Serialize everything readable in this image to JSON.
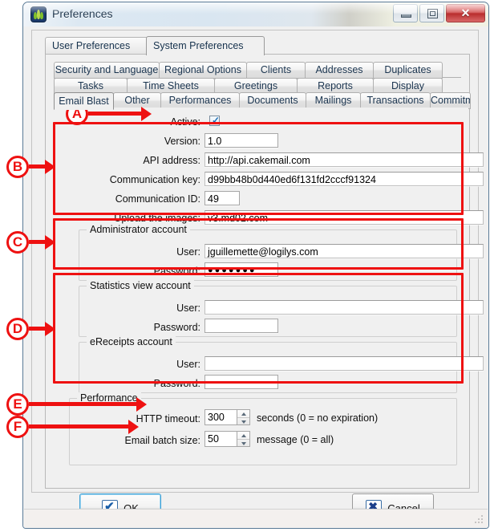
{
  "window": {
    "title": "Preferences",
    "app_icon": "logilys-app-icon",
    "controls": {
      "minimize": "minimize-icon",
      "restore": "restore-icon",
      "close": "✕"
    }
  },
  "tabs_level1": [
    {
      "label": "User Preferences",
      "active": false
    },
    {
      "label": "System Preferences",
      "active": true
    }
  ],
  "tabs_level2_row1": [
    {
      "label": "Security and Language",
      "active": false
    },
    {
      "label": "Regional Options",
      "active": false
    },
    {
      "label": "Clients",
      "active": false
    },
    {
      "label": "Addresses",
      "active": false
    },
    {
      "label": "Duplicates",
      "active": false
    }
  ],
  "tabs_level2_row2": [
    {
      "label": "Tasks",
      "active": false
    },
    {
      "label": "Time Sheets",
      "active": false
    },
    {
      "label": "Greetings",
      "active": false
    },
    {
      "label": "Reports",
      "active": false
    },
    {
      "label": "Display",
      "active": false
    }
  ],
  "tabs_level2_row3": [
    {
      "label": "Email Blast",
      "active": true
    },
    {
      "label": "Other",
      "active": false
    },
    {
      "label": "Performances",
      "active": false
    },
    {
      "label": "Documents",
      "active": false
    },
    {
      "label": "Mailings",
      "active": false
    },
    {
      "label": "Transactions",
      "active": false
    },
    {
      "label": "Commitments",
      "active": false
    }
  ],
  "form": {
    "active": {
      "label": "Active:",
      "checked": true,
      "tick": "✓"
    },
    "version": {
      "label": "Version:",
      "value": "1.0"
    },
    "api_address": {
      "label": "API address:",
      "value": "http://api.cakemail.com"
    },
    "communication_key": {
      "label": "Communication key:",
      "value": "d99bb48b0d440ed6f131fd2cccf91324"
    },
    "communication_id": {
      "label": "Communication ID:",
      "value": "49"
    },
    "upload_images": {
      "label": "Upload the images:",
      "value": "v3.md02.com"
    }
  },
  "administrator_account": {
    "title": "Administrator account",
    "user": {
      "label": "User:",
      "value": "jguillemette@logilys.com"
    },
    "password": {
      "label": "Password:",
      "value": "●●●●●●●"
    }
  },
  "statistics_view_account": {
    "title": "Statistics view account",
    "user": {
      "label": "User:",
      "value": ""
    },
    "password": {
      "label": "Password:",
      "value": ""
    }
  },
  "ereceipts_account": {
    "title": "eReceipts account",
    "user": {
      "label": "User:",
      "value": ""
    },
    "password": {
      "label": "Password:",
      "value": ""
    }
  },
  "performance": {
    "title": "Performance",
    "http_timeout": {
      "label": "HTTP timeout:",
      "value": "300",
      "unit": "seconds (0 = no expiration)"
    },
    "email_batch_size": {
      "label": "Email batch size:",
      "value": "50",
      "unit": "message (0 = all)"
    }
  },
  "buttons": {
    "ok": {
      "label": "OK",
      "accel": "O",
      "rest": "K",
      "icon": "checkmark-icon"
    },
    "cancel": {
      "label": "Cancel",
      "pre": "C",
      "accel": "a",
      "rest": "ncel",
      "icon": "cross-icon"
    }
  },
  "annotations": {
    "a": "A",
    "b": "B",
    "c": "C",
    "d": "D",
    "e": "E",
    "f": "F",
    "color": "#ee1111"
  }
}
